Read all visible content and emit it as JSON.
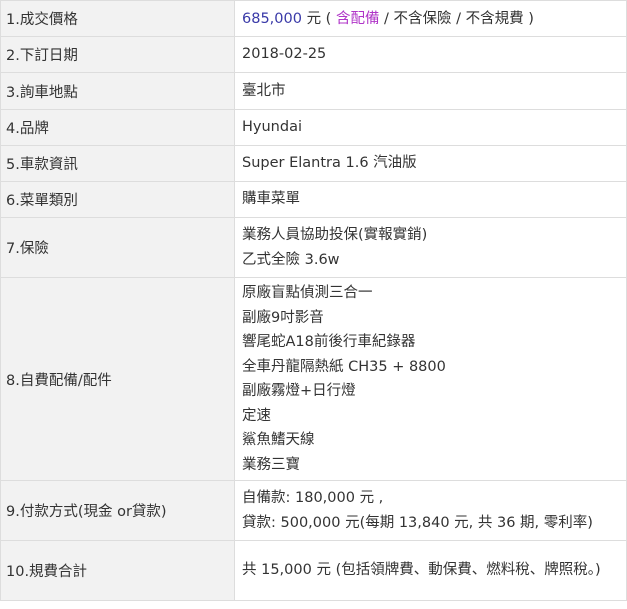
{
  "rows": [
    {
      "label": "1.成交價格",
      "price": {
        "amount": "685,000",
        "unit_open": " 元 ( ",
        "included": "含配備",
        "rest": " / 不含保險 / 不含規費 )"
      }
    },
    {
      "label": "2.下訂日期",
      "value": "2018-02-25"
    },
    {
      "label": "3.詢車地點",
      "value": "臺北市"
    },
    {
      "label": "4.品牌",
      "value": "Hyundai"
    },
    {
      "label": "5.車款資訊",
      "value": "Super Elantra 1.6 汽油版"
    },
    {
      "label": "6.菜單類別",
      "value": "購車菜單"
    },
    {
      "label": "7.保險",
      "lines": [
        "業務人員協助投保(實報實銷)",
        "乙式全險 3.6w"
      ]
    },
    {
      "label": "8.自費配備/配件",
      "lines": [
        "原廠盲點偵測三合一",
        "副廠9吋影音",
        "響尾蛇A18前後行車紀錄器",
        "全車丹龍隔熱紙 CH35 + 8800",
        "副廠霧燈+日行燈",
        "定速",
        "鯊魚鰭天線",
        "業務三寶"
      ]
    },
    {
      "label": "9.付款方式(現金 or貸款)",
      "lines": [
        "自備款: 180,000 元 ,",
        "貸款: 500,000 元(每期 13,840 元, 共 36 期, 零利率)"
      ]
    },
    {
      "label": "10.規費合計",
      "value": "共 15,000 元 (包括領牌費、動保費、燃料稅、牌照稅。)"
    }
  ]
}
